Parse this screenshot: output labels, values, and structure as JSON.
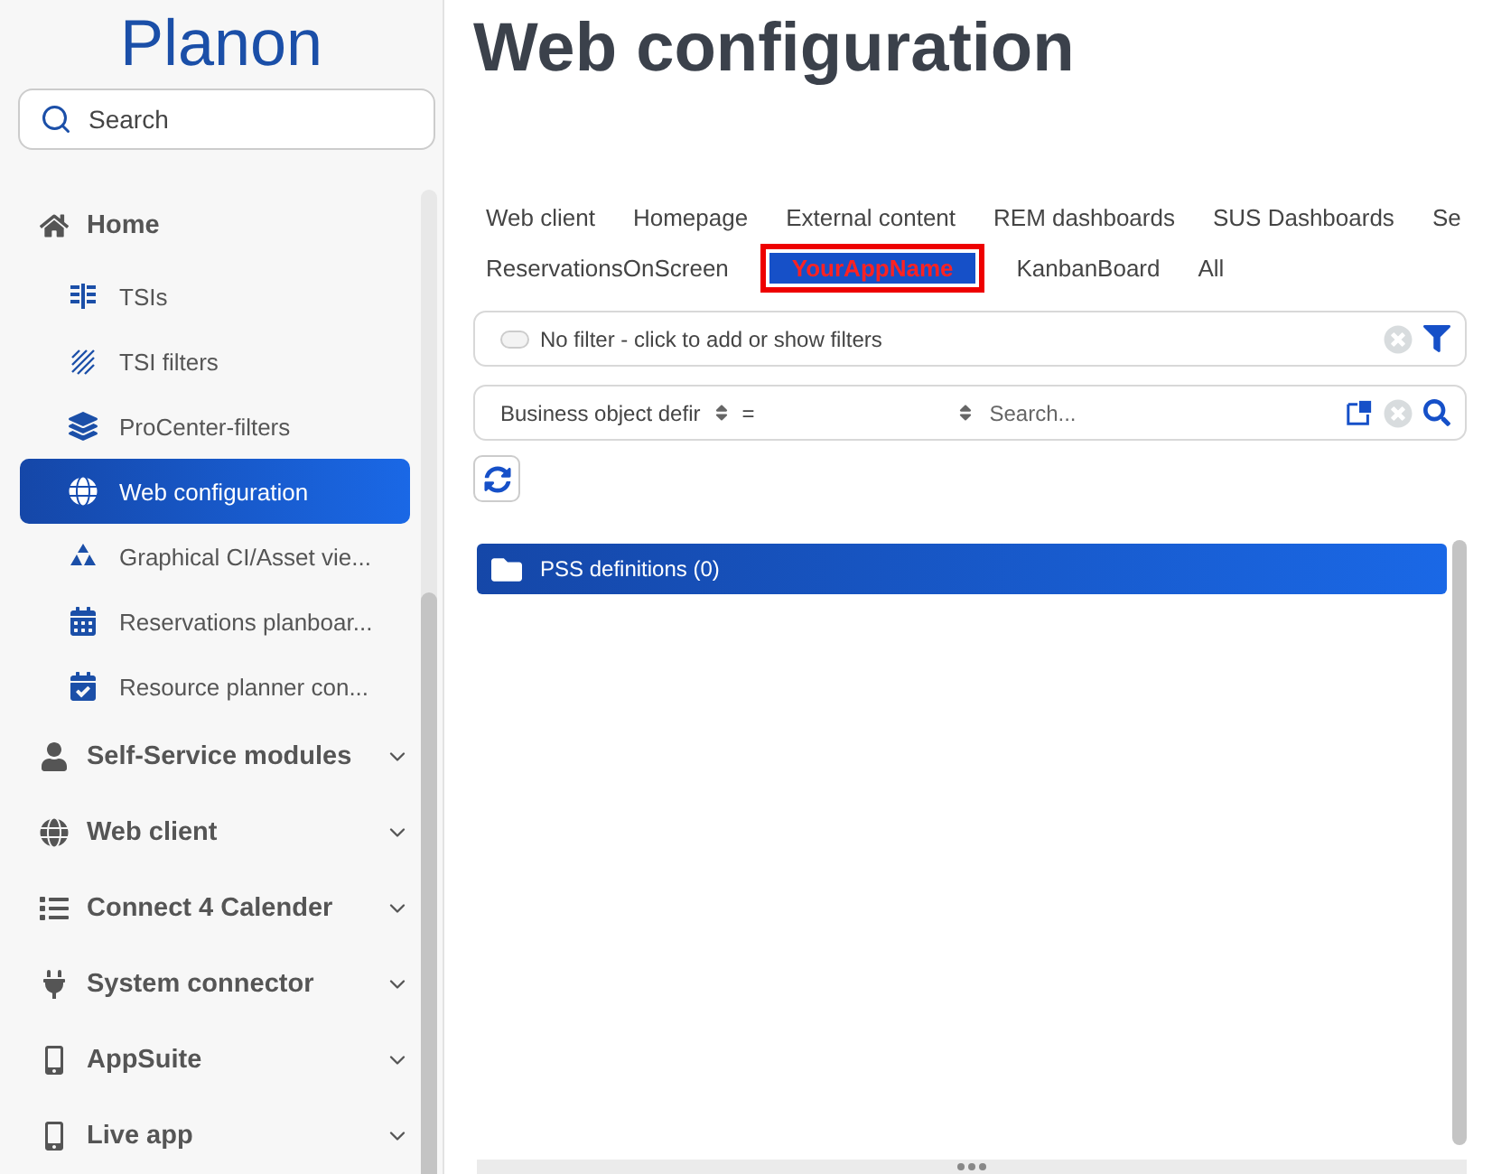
{
  "sidebar": {
    "logo": "Planon",
    "search": {
      "placeholder": "Search"
    },
    "items": [
      {
        "label": "Home",
        "expanded": true,
        "children": [
          {
            "label": "TSIs",
            "selected": false
          },
          {
            "label": "TSI filters",
            "selected": false
          },
          {
            "label": "ProCenter-filters",
            "selected": false
          },
          {
            "label": "Web configuration",
            "selected": true
          },
          {
            "label": "Graphical CI/Asset vie...",
            "selected": false
          },
          {
            "label": "Reservations planboar...",
            "selected": false
          },
          {
            "label": "Resource planner con...",
            "selected": false
          }
        ]
      },
      {
        "label": "Self-Service modules",
        "expanded": false
      },
      {
        "label": "Web client",
        "expanded": false
      },
      {
        "label": "Connect 4 Calender",
        "expanded": false
      },
      {
        "label": "System connector",
        "expanded": false
      },
      {
        "label": "AppSuite",
        "expanded": false
      },
      {
        "label": "Live app",
        "expanded": false
      }
    ]
  },
  "main": {
    "title": "Web configuration",
    "tab_rows": [
      [
        {
          "label": "Web client",
          "selected": false,
          "highlighted": false
        },
        {
          "label": "Homepage",
          "selected": false,
          "highlighted": false
        },
        {
          "label": "External content",
          "selected": false,
          "highlighted": false
        },
        {
          "label": "REM dashboards",
          "selected": false,
          "highlighted": false
        },
        {
          "label": "SUS Dashboards",
          "selected": false,
          "highlighted": false
        },
        {
          "label": "Se",
          "selected": false,
          "highlighted": false
        }
      ],
      [
        {
          "label": "ReservationsOnScreen",
          "selected": false,
          "highlighted": false
        },
        {
          "label": "YourAppName",
          "selected": true,
          "highlighted": true
        },
        {
          "label": "KanbanBoard",
          "selected": false,
          "highlighted": false
        },
        {
          "label": "All",
          "selected": false,
          "highlighted": false
        }
      ]
    ],
    "filter_bar": {
      "text": "No filter - click to add or show filters",
      "on": false
    },
    "search_bar": {
      "field": "Business object defir",
      "operator": "=",
      "placeholder": "Search..."
    },
    "groups": [
      {
        "label": "PSS definitions (0)"
      }
    ]
  }
}
